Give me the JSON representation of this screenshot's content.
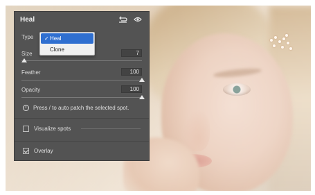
{
  "panel": {
    "title": "Heal",
    "icons": [
      "reset-icon",
      "visibility-eye-icon"
    ],
    "type": {
      "label": "Type",
      "selected": "Heal",
      "options": [
        {
          "label": "Heal",
          "checked": true
        },
        {
          "label": "Clone",
          "checked": false
        }
      ]
    },
    "size": {
      "label": "Size",
      "value": "7"
    },
    "feather": {
      "label": "Feather",
      "value": "100"
    },
    "opacity": {
      "label": "Opacity",
      "value": "100"
    },
    "hint": "Press / to auto patch the selected spot.",
    "visualize_spots": {
      "label": "Visualize spots",
      "checked": false
    },
    "overlay": {
      "label": "Overlay",
      "checked": true
    }
  },
  "colors": {
    "panel_bg": "#535353",
    "menu_highlight": "#2f6fd0"
  }
}
